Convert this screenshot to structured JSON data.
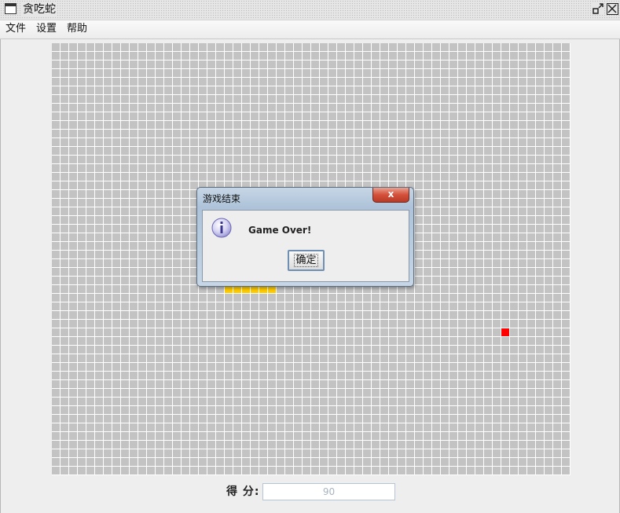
{
  "window": {
    "title": "贪吃蛇"
  },
  "menu": {
    "items": [
      "文件",
      "设置",
      "帮助"
    ]
  },
  "board": {
    "columns": 60,
    "rows": 50,
    "cell_color": "#c3c3c3",
    "snake_color": "#ffcc00",
    "food_color": "#ff0000",
    "snake": [
      [
        20,
        28
      ],
      [
        21,
        28
      ],
      [
        22,
        28
      ],
      [
        23,
        28
      ],
      [
        24,
        28
      ],
      [
        25,
        28
      ]
    ],
    "food": [
      52,
      33
    ]
  },
  "score": {
    "label": "得  分:",
    "value": "90"
  },
  "dialog": {
    "title": "游戏结束",
    "message": "Game Over!",
    "ok_label": "确定",
    "close_label": "x",
    "icon": "info-icon"
  },
  "icons": {
    "app": "window-icon",
    "restore": "restore-icon",
    "close": "close-icon"
  }
}
